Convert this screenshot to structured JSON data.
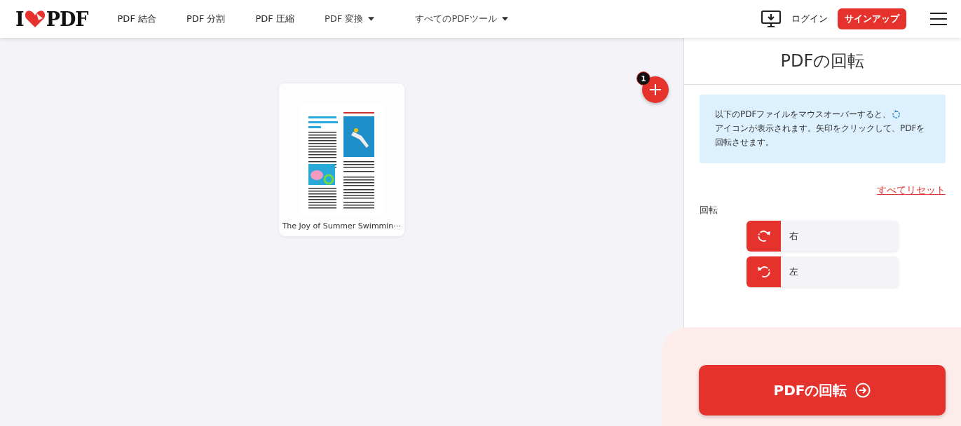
{
  "header": {
    "logo": {
      "left": "I",
      "right": "PDF"
    },
    "nav": [
      {
        "label": "PDF 結合",
        "dropdown": false
      },
      {
        "label": "PDF 分割",
        "dropdown": false
      },
      {
        "label": "PDF 圧縮",
        "dropdown": false
      },
      {
        "label": "PDF 変換",
        "dropdown": true
      },
      {
        "label": "すべてのPDFツール",
        "dropdown": true
      }
    ],
    "login": "ログイン",
    "signup": "サインアップ"
  },
  "workspace": {
    "file_count": "1",
    "files": [
      {
        "name": "The Joy of Summer Swimmin⋯"
      }
    ]
  },
  "panel": {
    "title": "PDFの回転",
    "info_before": "以下のPDFファイルをマウスオーバーすると、",
    "info_after": "アイコンが表示されます。矢印をクリックして、PDFを回転させます。",
    "reset": "すべてリセット",
    "rotation_label": "回転",
    "options": [
      {
        "kind": "right",
        "label": "右"
      },
      {
        "kind": "left",
        "label": "左"
      }
    ],
    "submit": "PDFの回転"
  }
}
